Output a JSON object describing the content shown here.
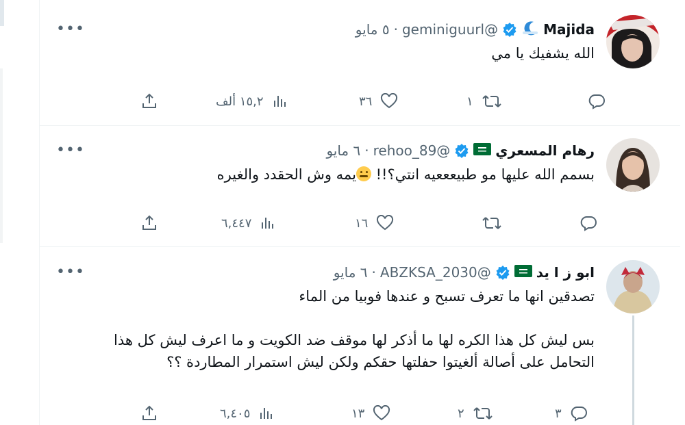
{
  "tweets": [
    {
      "name": "Majida",
      "name_emoji": "moon-icon",
      "verified": true,
      "flag": null,
      "handle": "@geminiguurl",
      "separator": "·",
      "time": "٥ مايو",
      "lines": [
        "الله يشفيك يا مي"
      ],
      "reply_count": "",
      "retweet_count": "١",
      "like_count": "٣٦",
      "views": "١٥,٢ ألف"
    },
    {
      "name": "رهام المسعري",
      "verified": true,
      "flag": "saudi-flag-icon",
      "handle": "@rehoo_89",
      "separator": "·",
      "time": "٦ مايو",
      "line_before_emoji": "بسمم الله عليها مو طبيعععيه انتي؟!!",
      "line_after_emoji": "يمه وش الحقدد والغيره",
      "reply_count": "",
      "retweet_count": "",
      "like_count": "١٦",
      "views": "٦,٤٤٧"
    },
    {
      "name": "ابو ز ا يد",
      "verified": true,
      "flag": "saudi-flag-icon",
      "handle": "@ABZKSA_2030",
      "separator": "·",
      "time": "٦ مايو",
      "lines": [
        "تصدقين انها ما تعرف تسبح و عندها فوبيا من الماء",
        "بس ليش كل هذا الكره لها ما أذكر لها موقف ضد الكويت و ما اعرف ليش كل هذا",
        "التحامل على أصالة ألغيتوا حفلتها حقكم ولكن ليش استمرار المطاردة ؟؟"
      ],
      "reply_count": "٣",
      "retweet_count": "٢",
      "like_count": "١٣",
      "views": "٦,٤٠٥"
    }
  ],
  "more_label": "•••",
  "colors": {
    "verified": "#1d9bf0",
    "muted": "#536471",
    "saudi_green": "#006c35"
  }
}
